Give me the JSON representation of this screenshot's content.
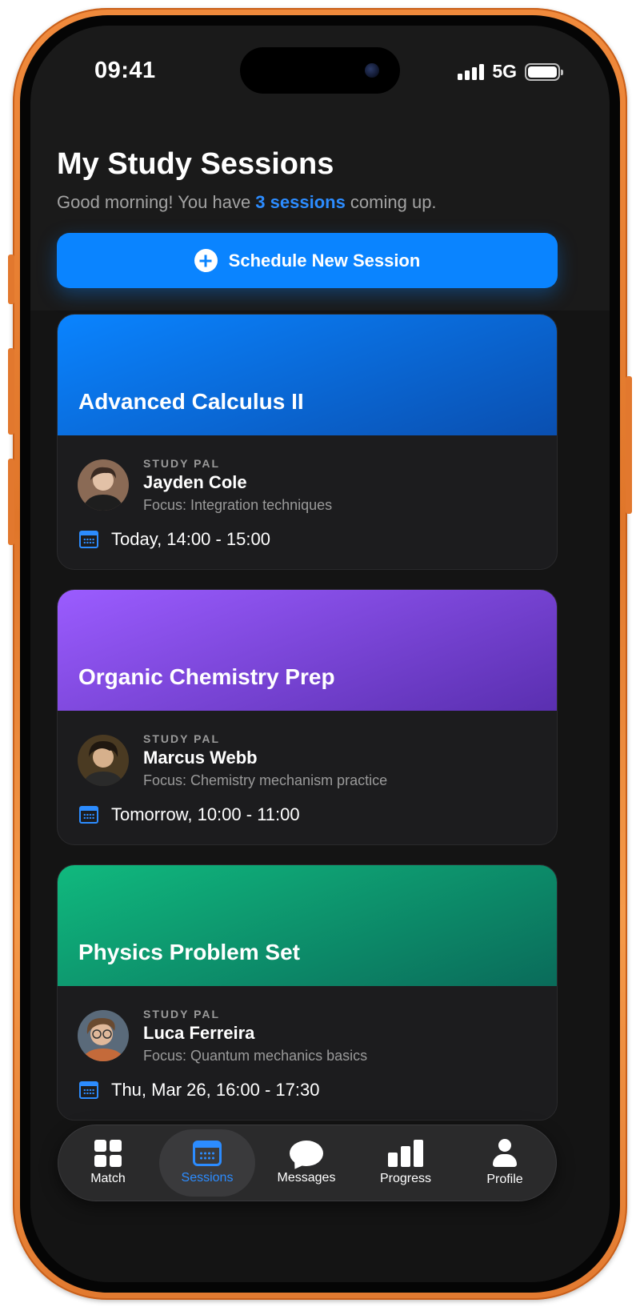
{
  "status_bar": {
    "time": "09:41",
    "network": "5G",
    "signal_bars": 4,
    "battery_percent": 100
  },
  "header": {
    "title": "My Study Sessions",
    "greeting_prefix": "Good morning! You have ",
    "greeting_highlight": "3 sessions",
    "greeting_suffix": " coming up.",
    "schedule_button": "Schedule New Session"
  },
  "sessions": [
    {
      "title": "Advanced Calculus II",
      "gradient": [
        "#0a84ff",
        "#0a4fb0"
      ],
      "pal_label": "STUDY PAL",
      "pal_name": "Jayden Cole",
      "focus": "Focus: Integration techniques",
      "when": "Today, 14:00 - 15:00"
    },
    {
      "title": "Organic Chemistry Prep",
      "gradient": [
        "#9b5cff",
        "#5a2fb0"
      ],
      "pal_label": "STUDY PAL",
      "pal_name": "Marcus Webb",
      "focus": "Focus: Chemistry mechanism practice",
      "when": "Tomorrow, 10:00 - 11:00"
    },
    {
      "title": "Physics Problem Set",
      "gradient": [
        "#10b97e",
        "#0a6b5a"
      ],
      "pal_label": "STUDY PAL",
      "pal_name": "Luca Ferreira",
      "focus": "Focus: Quantum mechanics basics",
      "when": "Thu, Mar 26, 16:00 - 17:30"
    }
  ],
  "tabs": [
    {
      "label": "Match",
      "icon": "grid-icon",
      "active": false
    },
    {
      "label": "Sessions",
      "icon": "calendar-icon",
      "active": true
    },
    {
      "label": "Messages",
      "icon": "chat-bubble-icon",
      "active": false
    },
    {
      "label": "Progress",
      "icon": "bar-chart-icon",
      "active": false
    },
    {
      "label": "Profile",
      "icon": "person-icon",
      "active": false
    }
  ],
  "colors": {
    "accent": "#0a84ff",
    "background": "#141414",
    "card": "#1c1c1e",
    "frame": "#f08a3c"
  }
}
